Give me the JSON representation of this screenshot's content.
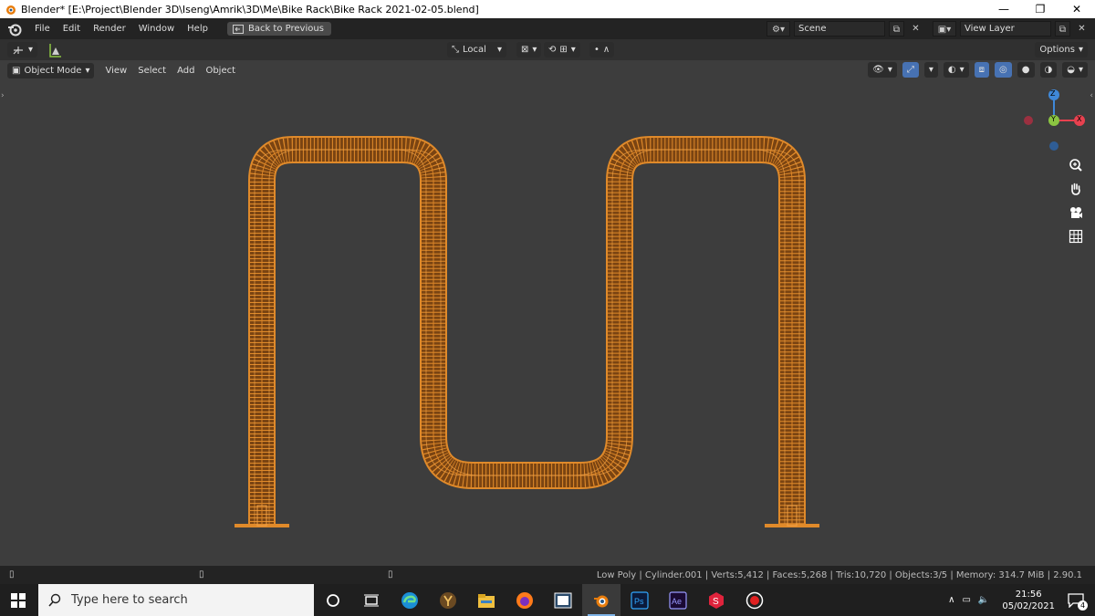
{
  "window": {
    "title": "Blender* [E:\\Project\\Blender 3D\\Iseng\\Amrik\\3D\\Me\\Bike Rack\\Bike Rack 2021-02-05.blend]",
    "minimize": "—",
    "restore": "❐",
    "close": "✕"
  },
  "menubar": {
    "items": [
      "File",
      "Edit",
      "Render",
      "Window",
      "Help"
    ],
    "back_label": "Back to Previous",
    "scene_label": "Scene",
    "view_layer_label": "View Layer"
  },
  "toolbar": {
    "pivot_label": "Local",
    "options_label": "Options"
  },
  "viewport_header": {
    "mode_label": "Object Mode",
    "menu": [
      "View",
      "Select",
      "Add",
      "Object"
    ]
  },
  "gizmo": {
    "z_label": "Z",
    "y_label": "Y",
    "x_label": "X",
    "colors": {
      "x": "#e8414f",
      "y": "#8bc541",
      "z": "#3f88d8"
    }
  },
  "model": {
    "wire_color": "#e08a2a",
    "dark_wire_color": "#8a4d12"
  },
  "status": {
    "stats": "Low Poly | Cylinder.001 | Verts:5,412 | Faces:5,268 | Tris:10,720 | Objects:3/5 | Memory: 314.7 MiB | 2.90.1"
  },
  "taskbar": {
    "search_placeholder": "Type here to search",
    "time": "21:56",
    "date": "05/02/2021",
    "notif_count": "4"
  }
}
